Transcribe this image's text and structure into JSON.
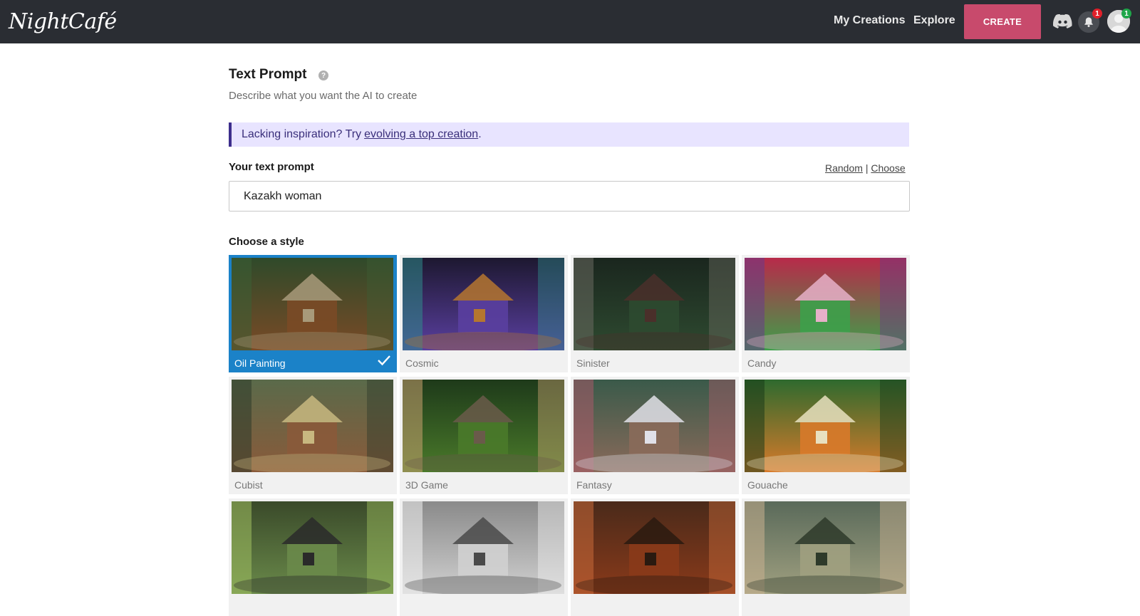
{
  "navbar": {
    "logo_text": "NightCafé",
    "links": [
      "My Creations",
      "Explore"
    ],
    "create_label": "CREATE",
    "notification_count": "1",
    "profile_count": "1"
  },
  "prompt_section": {
    "title": "Text Prompt",
    "help_glyph": "?",
    "subtitle": "Describe what you want the AI to create",
    "inspiration_prefix": "Lacking inspiration? Try",
    "inspiration_link": "evolving a top creation",
    "inspiration_suffix": ".",
    "prompt_label": "Your text prompt",
    "random_label": "Random",
    "separator": "|",
    "choose_label": "Choose",
    "prompt_value": "Kazakh woman"
  },
  "styles": {
    "label": "Choose a style",
    "selected": "Oil Painting",
    "items": [
      {
        "name": "Oil Painting",
        "selected": true,
        "palette": [
          "#2f4a2a",
          "#7a4a26",
          "#a89a7a",
          "#3d5e34"
        ]
      },
      {
        "name": "Cosmic",
        "selected": false,
        "palette": [
          "#1d1830",
          "#5a3fa0",
          "#b5762f",
          "#2f8a8a"
        ]
      },
      {
        "name": "Sinister",
        "selected": false,
        "palette": [
          "#1a261e",
          "#2e4a30",
          "#4a2f2a",
          "#6a6a60"
        ]
      },
      {
        "name": "Candy",
        "selected": false,
        "palette": [
          "#b82a4a",
          "#3da04a",
          "#e6b0c8",
          "#6a3a8a"
        ]
      },
      {
        "name": "Cubist",
        "selected": false,
        "palette": [
          "#5a6a4a",
          "#8a5a3a",
          "#c8b880",
          "#2e3a2a"
        ]
      },
      {
        "name": "3D Game",
        "selected": false,
        "palette": [
          "#1e3a1a",
          "#4a7a2a",
          "#6a5a4a",
          "#c8a070"
        ]
      },
      {
        "name": "Fantasy",
        "selected": false,
        "palette": [
          "#3a5a4a",
          "#8a6a5a",
          "#e0e0e8",
          "#a85a6a"
        ]
      },
      {
        "name": "Gouache",
        "selected": false,
        "palette": [
          "#2e6a2e",
          "#d87a2a",
          "#e8e0c0",
          "#1a3a1a"
        ]
      },
      {
        "name": "",
        "selected": false,
        "palette": [
          "#3a4a2a",
          "#6a8a4a",
          "#2a2a2a",
          "#a0c060"
        ]
      },
      {
        "name": "",
        "selected": false,
        "palette": [
          "#8a8a8a",
          "#d0d0d0",
          "#4a4a4a",
          "#f0f0f0"
        ]
      },
      {
        "name": "",
        "selected": false,
        "palette": [
          "#4a2a1a",
          "#8a3a1a",
          "#2a1a10",
          "#c86a3a"
        ]
      },
      {
        "name": "",
        "selected": false,
        "palette": [
          "#5a6a5a",
          "#a0a080",
          "#2e3a2a",
          "#c8b090"
        ]
      }
    ]
  }
}
